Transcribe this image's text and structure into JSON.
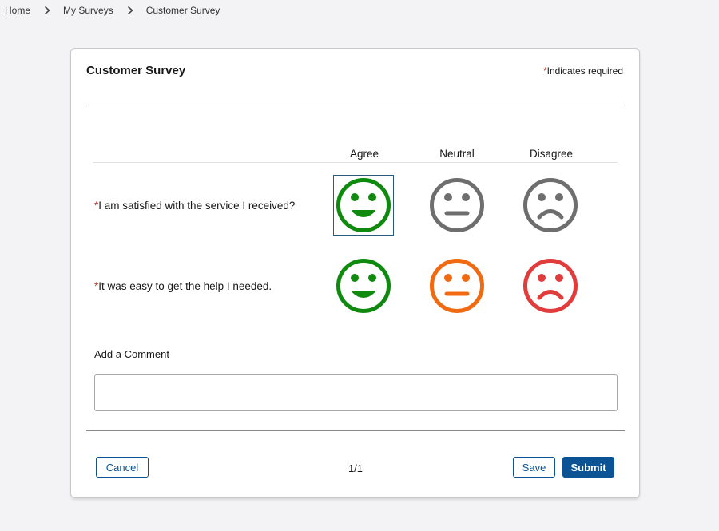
{
  "breadcrumb": [
    "Home",
    "My Surveys",
    "Customer Survey"
  ],
  "survey": {
    "title": "Customer Survey",
    "required_marker": "*",
    "required_note": "Indicates required"
  },
  "columns": [
    "Agree",
    "Neutral",
    "Disagree"
  ],
  "questions": [
    {
      "required_marker": "*",
      "text": "I am satisfied with the service I received?"
    },
    {
      "required_marker": "*",
      "text": "It was easy to get the help I needed."
    }
  ],
  "faces": {
    "row1": {
      "agree": "happy-face-icon",
      "neutral": "neutral-face-icon",
      "disagree": "sad-face-icon",
      "selected": "Agree"
    },
    "row2": {
      "agree": "happy-face-icon",
      "neutral": "neutral-face-icon",
      "disagree": "sad-face-icon"
    }
  },
  "colors": {
    "agree": "#0f8a0f",
    "neutral_row1": "#6e6e6e",
    "disagree_row1": "#6e6e6e",
    "neutral_row2": "#f06a12",
    "disagree_row2": "#e03c3c",
    "primary": "#0b5394"
  },
  "comment": {
    "label": "Add a Comment",
    "value": "",
    "placeholder": ""
  },
  "footer": {
    "cancel_label": "Cancel",
    "page_indicator": "1/1",
    "save_label": "Save",
    "submit_label": "Submit"
  }
}
